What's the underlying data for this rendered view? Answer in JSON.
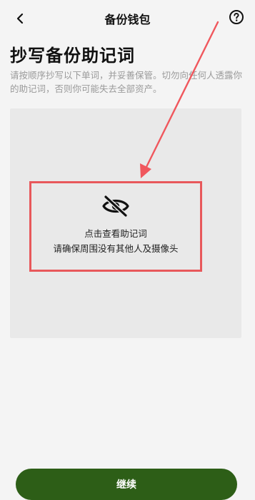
{
  "header": {
    "title": "备份钱包"
  },
  "main": {
    "page_title": "抄写备份助记词",
    "subtitle": "请按顺序抄写以下单词，并妥善保管。切勿向任何人透露你的助记词，否则你可能失去全部资产。"
  },
  "reveal": {
    "title": "点击查看助记词",
    "hint": "请确保周围没有其他人及摄像头"
  },
  "footer": {
    "continue_label": "继续"
  },
  "colors": {
    "accent": "#2d5e17",
    "highlight": "#e8585b",
    "background": "#f4f4f4",
    "panel": "#e9e9e9"
  },
  "icons": {
    "back": "chevron-left-icon",
    "help": "question-circle-icon",
    "hidden": "eye-off-icon"
  }
}
